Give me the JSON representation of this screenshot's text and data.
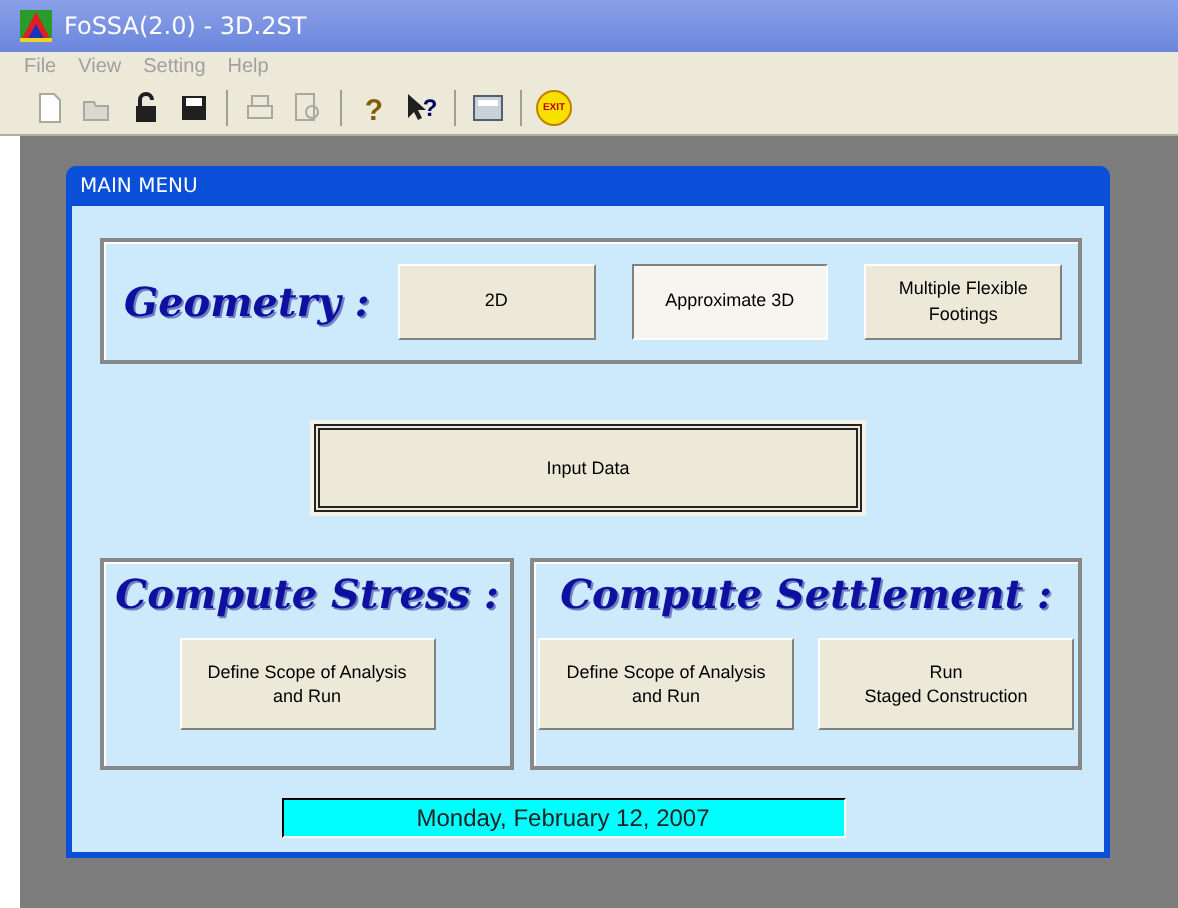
{
  "window": {
    "title": "FoSSA(2.0) - 3D.2ST"
  },
  "menu": [
    {
      "label": "File",
      "disabled": true
    },
    {
      "label": "View",
      "disabled": true
    },
    {
      "label": "Setting",
      "disabled": true
    },
    {
      "label": "Help",
      "disabled": true
    }
  ],
  "toolbar": [
    {
      "kind": "new",
      "disabled": true
    },
    {
      "kind": "open",
      "disabled": true
    },
    {
      "kind": "lock",
      "disabled": false
    },
    {
      "kind": "save",
      "disabled": false
    },
    {
      "kind": "sep"
    },
    {
      "kind": "print",
      "disabled": true
    },
    {
      "kind": "preview",
      "disabled": true
    },
    {
      "kind": "sep"
    },
    {
      "kind": "help",
      "disabled": false,
      "label": "?"
    },
    {
      "kind": "whatsthis",
      "disabled": false,
      "label": "?"
    },
    {
      "kind": "sep"
    },
    {
      "kind": "calc",
      "disabled": false
    },
    {
      "kind": "sep"
    },
    {
      "kind": "exit",
      "disabled": false,
      "label": "EXIT"
    }
  ],
  "dialog": {
    "title": "MAIN MENU",
    "geometry": {
      "heading": "Geometry :",
      "buttons": [
        {
          "label": "2D",
          "selected": false
        },
        {
          "label": "Approximate 3D",
          "selected": true
        },
        {
          "label": "Multiple Flexible Footings",
          "selected": false
        }
      ]
    },
    "input_button": {
      "label": "Input Data",
      "default": true
    },
    "groups": [
      {
        "heading": "Compute Stress :",
        "buttons": [
          "Define Scope of Analysis\nand Run"
        ]
      },
      {
        "heading": "Compute Settlement :",
        "buttons": [
          "Define Scope of Analysis\nand Run",
          "Run\nStaged Construction"
        ]
      }
    ],
    "date": "Monday, February 12, 2007"
  }
}
